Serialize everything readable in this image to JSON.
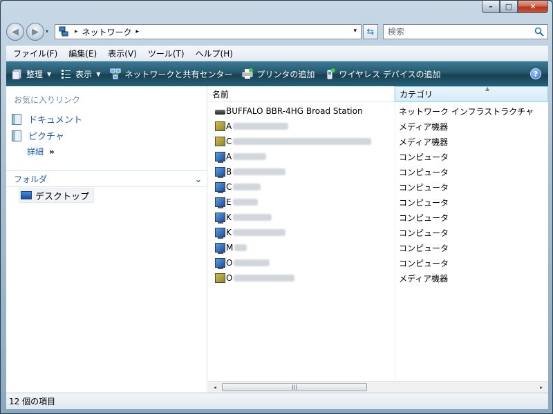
{
  "window": {
    "caption_minimize": "–",
    "caption_maximize": "□",
    "caption_close": "✕"
  },
  "address": {
    "root_arrow": "▸",
    "location": "ネットワーク",
    "after_arrow": "▸",
    "dropdown": "▾"
  },
  "search": {
    "placeholder": "検索"
  },
  "menu": [
    "ファイル(F)",
    "編集(E)",
    "表示(V)",
    "ツール(T)",
    "ヘルプ(H)"
  ],
  "commands": [
    {
      "label": "整理",
      "icon": "organize-icon",
      "has_dropdown": true
    },
    {
      "label": "表示",
      "icon": "views-icon",
      "has_dropdown": true
    },
    {
      "label": "ネットワークと共有センター",
      "icon": "network-center-icon"
    },
    {
      "label": "プリンタの追加",
      "icon": "printer-icon"
    },
    {
      "label": "ワイヤレス デバイスの追加",
      "icon": "wireless-device-icon"
    }
  ],
  "help_label": "?",
  "nav": {
    "favorites_title": "お気に入りリンク",
    "favorites": [
      {
        "label": "ドキュメント",
        "icon": "documents-icon"
      },
      {
        "label": "ピクチャ",
        "icon": "pictures-icon"
      }
    ],
    "more": "詳細",
    "more_chevron": "»",
    "folders_title": "フォルダ",
    "folders_chevron": "⌄",
    "tree_item": "デスクトップ"
  },
  "list": {
    "columns": [
      "名前",
      "カテゴリ"
    ],
    "sort_indicator": "▲",
    "rows": [
      {
        "name": "BUFFALO BBR-4HG Broad Station",
        "category": "ネットワーク インフラストラクチャ",
        "icon": "router-icon"
      },
      {
        "name": "A",
        "category": "メディア機器",
        "icon": "media-device-icon"
      },
      {
        "name": "C",
        "category": "メディア機器",
        "icon": "media-device-icon"
      },
      {
        "name": "A",
        "category": "コンピュータ",
        "icon": "computer-icon"
      },
      {
        "name": "B",
        "category": "コンピュータ",
        "icon": "computer-icon"
      },
      {
        "name": "C",
        "category": "コンピュータ",
        "icon": "computer-icon"
      },
      {
        "name": "E",
        "category": "コンピュータ",
        "icon": "computer-icon"
      },
      {
        "name": "K",
        "category": "コンピュータ",
        "icon": "computer-icon"
      },
      {
        "name": "K",
        "category": "コンピュータ",
        "icon": "computer-icon"
      },
      {
        "name": "M",
        "category": "コンピュータ",
        "icon": "computer-icon"
      },
      {
        "name": "O",
        "category": "コンピュータ",
        "icon": "computer-icon"
      },
      {
        "name": "O",
        "category": "メディア機器",
        "icon": "media-device-icon"
      }
    ]
  },
  "scrollbar": {
    "left": "◂",
    "right": "▸",
    "grip": "|||"
  },
  "status": {
    "text": "12 個の項目"
  },
  "colors": {
    "link": "#1d5caa",
    "command_bar": "#25586d",
    "selected_column": "#d6ebf9"
  }
}
